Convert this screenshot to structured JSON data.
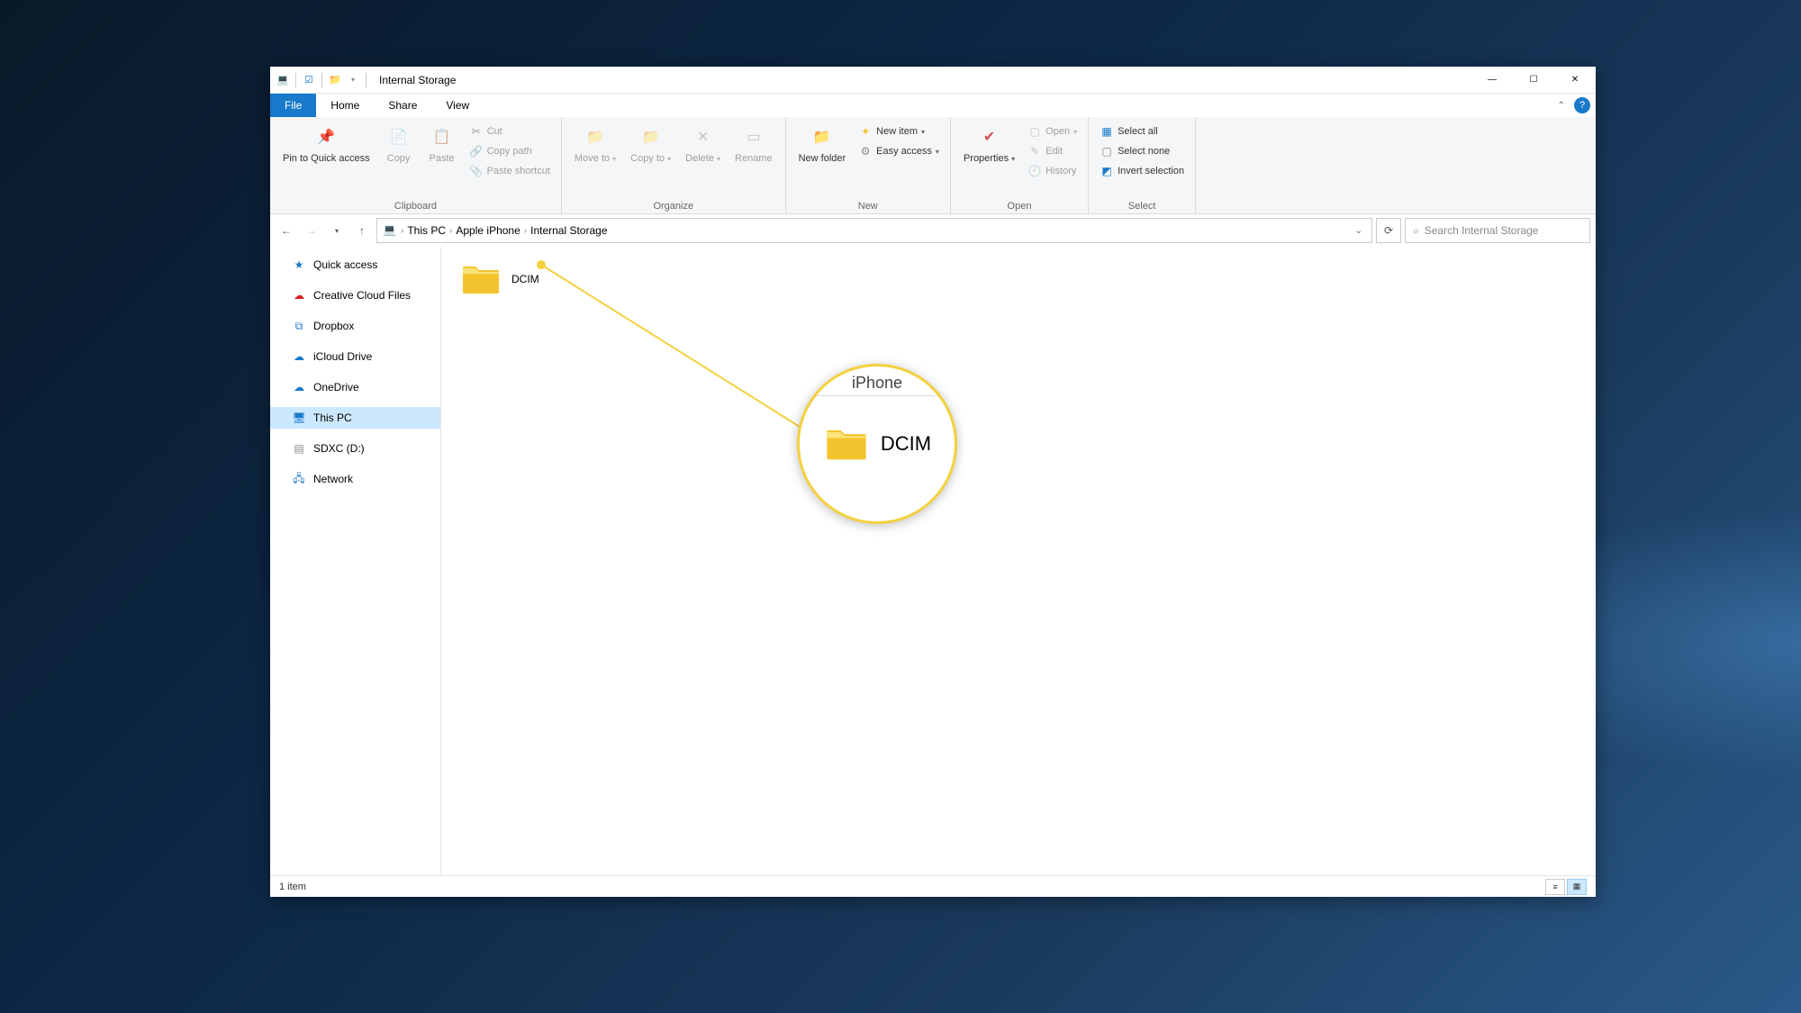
{
  "title": "Internal Storage",
  "window_controls": {
    "min": "—",
    "max": "☐",
    "close": "✕"
  },
  "tabs": {
    "file": "File",
    "home": "Home",
    "share": "Share",
    "view": "View"
  },
  "ribbon": {
    "clipboard": {
      "label": "Clipboard",
      "pin": "Pin to Quick access",
      "copy": "Copy",
      "paste": "Paste",
      "cut": "Cut",
      "copy_path": "Copy path",
      "paste_shortcut": "Paste shortcut"
    },
    "organize": {
      "label": "Organize",
      "move_to": "Move to",
      "copy_to": "Copy to",
      "delete": "Delete",
      "rename": "Rename"
    },
    "new": {
      "label": "New",
      "new_folder": "New folder",
      "new_item": "New item",
      "easy_access": "Easy access"
    },
    "open": {
      "label": "Open",
      "properties": "Properties",
      "open": "Open",
      "edit": "Edit",
      "history": "History"
    },
    "select": {
      "label": "Select",
      "select_all": "Select all",
      "select_none": "Select none",
      "invert": "Invert selection"
    }
  },
  "breadcrumbs": [
    "This PC",
    "Apple iPhone",
    "Internal Storage"
  ],
  "search_placeholder": "Search Internal Storage",
  "sidebar": {
    "quick_access": "Quick access",
    "creative_cloud": "Creative Cloud Files",
    "dropbox": "Dropbox",
    "icloud": "iCloud Drive",
    "onedrive": "OneDrive",
    "this_pc": "This PC",
    "sdxc": "SDXC (D:)",
    "network": "Network"
  },
  "content": {
    "folder": "DCIM"
  },
  "magnifier": {
    "top_text": "iPhone",
    "label": "DCIM"
  },
  "status": {
    "text": "1 item"
  }
}
